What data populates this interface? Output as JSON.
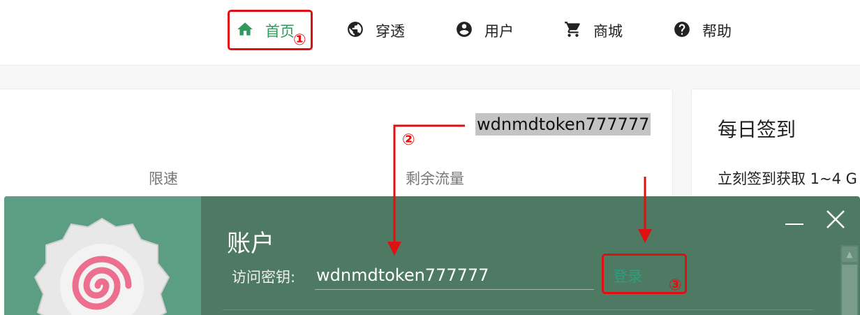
{
  "nav": {
    "items": [
      {
        "label": "首页",
        "icon": "home-icon"
      },
      {
        "label": "穿透",
        "icon": "globe-icon"
      },
      {
        "label": "用户",
        "icon": "account-circle-icon"
      },
      {
        "label": "商城",
        "icon": "cart-icon"
      },
      {
        "label": "帮助",
        "icon": "help-circle-icon"
      }
    ],
    "active_color": "#2e9a5c"
  },
  "main": {
    "token_text": "wdnmdtoken777777",
    "speed_label": "限速",
    "traffic_label": "剩余流量"
  },
  "checkin": {
    "title": "每日签到",
    "desc": "立刻签到获取 1~4 G"
  },
  "modal": {
    "title": "账户",
    "key_label": "访问密钥:",
    "key_value": "wdnmdtoken777777",
    "login_label": "登录",
    "bg_color": "#4e7962",
    "accent_color": "#2aa07f"
  },
  "annotations": {
    "step1": "①",
    "step2": "②",
    "step3": "③",
    "color": "#e01010"
  }
}
